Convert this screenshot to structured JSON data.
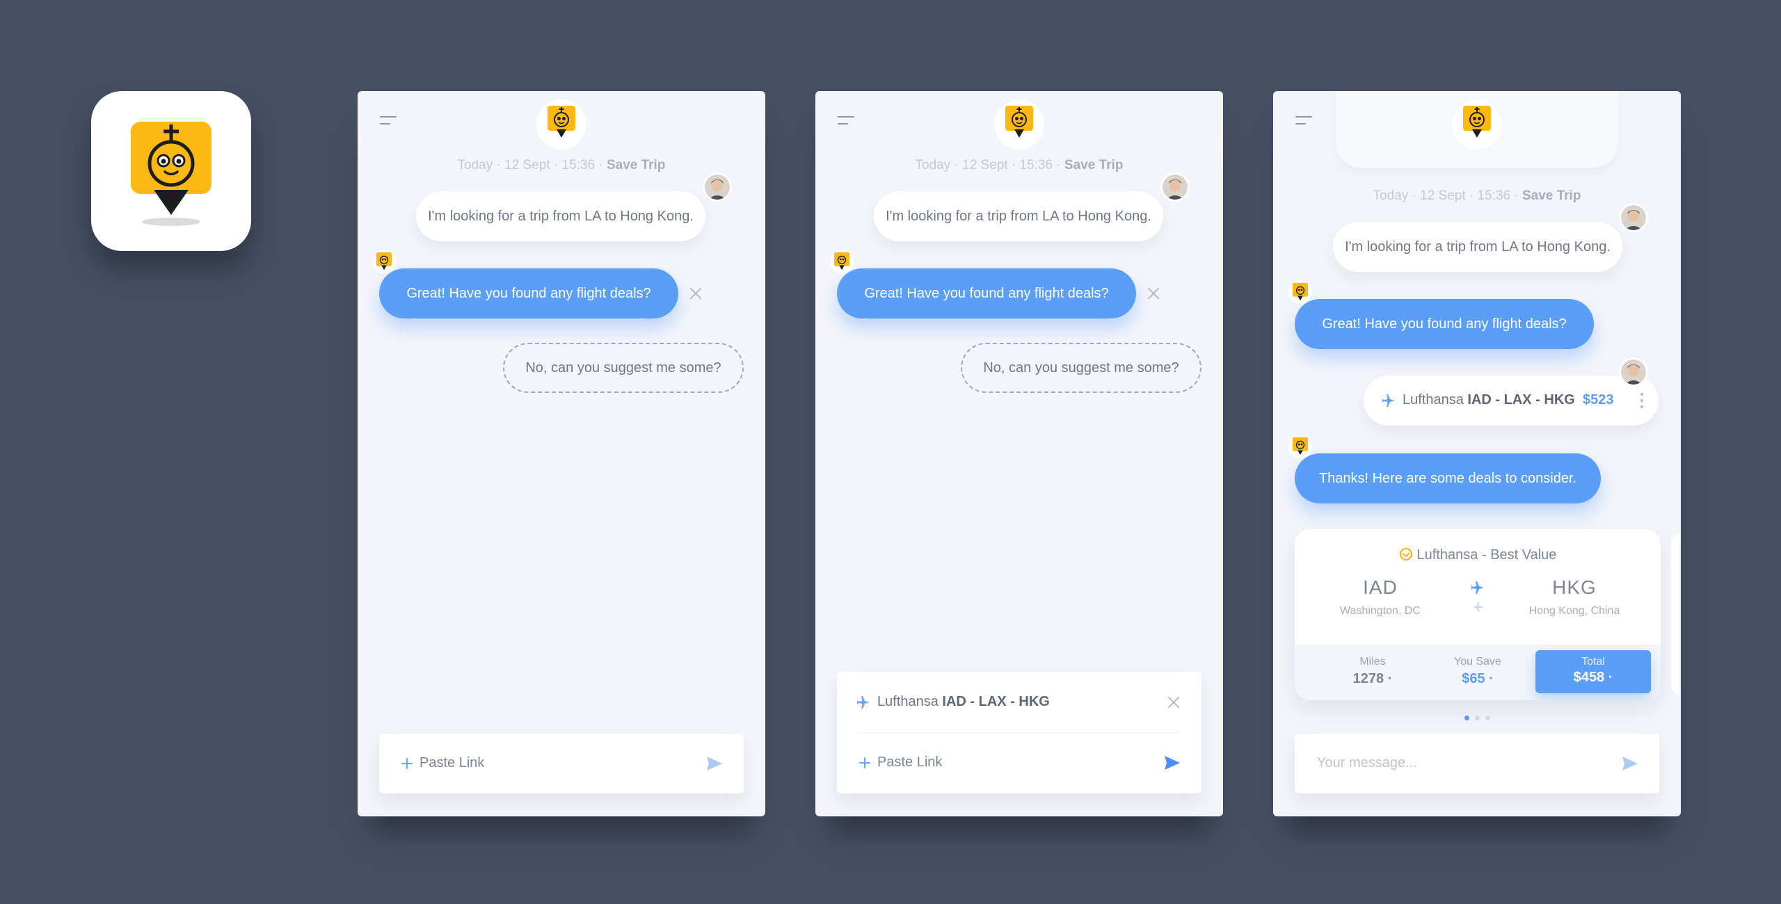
{
  "colors": {
    "background": "#474f63",
    "screen": "#f4f5fa",
    "accent": "#5b9ef7",
    "brand_yellow": "#fdb913"
  },
  "app_icon": {
    "name": "robot-logo-icon"
  },
  "screens": [
    {
      "timestamp_prefix": "Today · 12 Sept · 15:36 · ",
      "save_trip": "Save Trip",
      "user_message": "I'm looking for a trip from LA to Hong Kong.",
      "bot_message": "Great! Have you found any flight deals?",
      "suggestion": "No, can you suggest me some?",
      "input": {
        "paste_link": "Paste Link"
      }
    },
    {
      "timestamp_prefix": "Today · 12 Sept · 15:36 · ",
      "save_trip": "Save Trip",
      "user_message": "I'm looking for a trip from LA to Hong Kong.",
      "bot_message": "Great! Have you found any flight deals?",
      "suggestion": "No, can you suggest me some?",
      "link_preview": {
        "airline": "Lufthansa",
        "route": "IAD - LAX - HKG"
      },
      "input": {
        "paste_link": "Paste Link"
      }
    },
    {
      "timestamp_prefix": "Today · 12 Sept · 15:36 · ",
      "save_trip": "Save Trip",
      "user_message": "I'm looking for a trip from LA to Hong Kong.",
      "bot_message": "Great! Have you found any flight deals?",
      "flight_message": {
        "airline": "Lufthansa",
        "route": "IAD - LAX - HKG",
        "price": "$523"
      },
      "bot_message_2": "Thanks! Here are some deals to consider.",
      "deal": {
        "title": "Lufthansa - Best Value",
        "from_code": "IAD",
        "from_city": "Washington, DC",
        "to_code": "HKG",
        "to_city": "Hong Kong, China",
        "miles_label": "Miles",
        "miles_value": "1278",
        "save_label": "You Save",
        "save_value": "$65",
        "total_label": "Total",
        "total_value": "$458"
      },
      "carousel": {
        "count": 3,
        "active": 1
      },
      "input": {
        "placeholder": "Your message..."
      }
    }
  ]
}
